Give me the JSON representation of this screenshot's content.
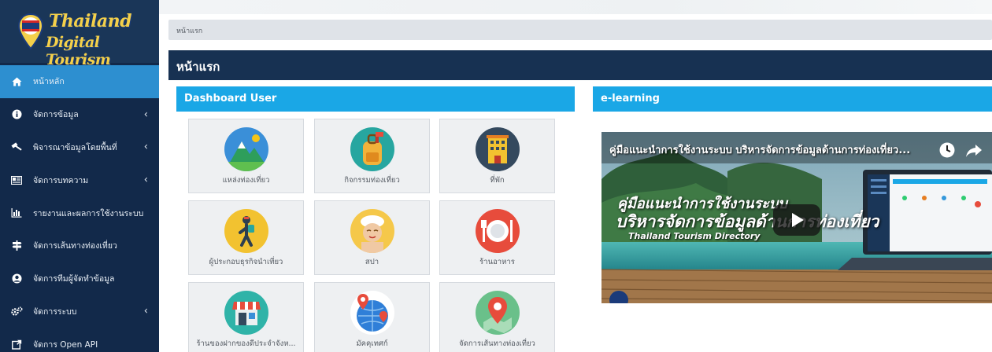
{
  "brand": {
    "line1": "Thailand",
    "line2": "Digital Tourism"
  },
  "sidebar": {
    "items": [
      {
        "label": "หน้าหลัก",
        "icon": "home-icon",
        "has_submenu": false,
        "active": true
      },
      {
        "label": "จัดการข้อมูล",
        "icon": "info-icon",
        "has_submenu": true,
        "active": false
      },
      {
        "label": "พิจารณาข้อมูลโดยพื้นที่",
        "icon": "gavel-icon",
        "has_submenu": true,
        "active": false
      },
      {
        "label": "จัดการบทความ",
        "icon": "newspaper-icon",
        "has_submenu": true,
        "active": false
      },
      {
        "label": "รายงานและผลการใช้งานระบบ",
        "icon": "bar-chart-icon",
        "has_submenu": false,
        "active": false
      },
      {
        "label": "จัดการเส้นทางท่องเที่ยว",
        "icon": "signpost-icon",
        "has_submenu": false,
        "active": false
      },
      {
        "label": "จัดการทีมผู้จัดทำข้อมูล",
        "icon": "user-circle-icon",
        "has_submenu": false,
        "active": false
      },
      {
        "label": "จัดการระบบ",
        "icon": "cogs-icon",
        "has_submenu": true,
        "active": false
      },
      {
        "label": "จัดการ Open API",
        "icon": "external-link-icon",
        "has_submenu": false,
        "active": false
      }
    ]
  },
  "breadcrumb": {
    "text": "หน้าแรก"
  },
  "page": {
    "title": "หน้าแรก"
  },
  "dashboard": {
    "title": "Dashboard User",
    "tiles": [
      {
        "label": "แหล่งท่องเที่ยว",
        "icon": "mountain-icon",
        "color": "#3a8fd8"
      },
      {
        "label": "กิจกรรมท่องเที่ยว",
        "icon": "backpack-icon",
        "color": "#27a6a0"
      },
      {
        "label": "ที่พัก",
        "icon": "hotel-icon",
        "color": "#34495e"
      },
      {
        "label": "ผู้ประกอบธุรกิจนำเที่ยว",
        "icon": "hiker-icon",
        "color": "#f2c230"
      },
      {
        "label": "สปา",
        "icon": "spa-icon",
        "color": "#f5c84a"
      },
      {
        "label": "ร้านอาหาร",
        "icon": "restaurant-icon",
        "color": "#e74c3c"
      },
      {
        "label": "ร้านของฝากของดีประจำจังห...",
        "icon": "shop-icon",
        "color": "#2fb3a8"
      },
      {
        "label": "มัคคุเทศก์",
        "icon": "globe-pin-icon",
        "color": "#2f7fd8"
      },
      {
        "label": "จัดการเส้นทางท่องเที่ยว",
        "icon": "map-pin-icon",
        "color": "#6ac08a"
      }
    ]
  },
  "elearning": {
    "title": "e-learning",
    "video": {
      "title": "คู่มือแนะนำการใช้งานระบบ บริหารจัดการข้อมูลด้านการท่องเที่ยว...",
      "line1": "คู่มือแนะนำการใช้งานระบบ",
      "line2": "บริหารจัดการข้อมูลด้านการท่องเที่ยว",
      "line3": "Thailand Tourism Directory"
    }
  },
  "colors": {
    "sidebar_bg": "#12294a",
    "sidebar_active": "#2d8fd0",
    "panel_head": "#1aa7e6",
    "page_header": "#173152"
  }
}
